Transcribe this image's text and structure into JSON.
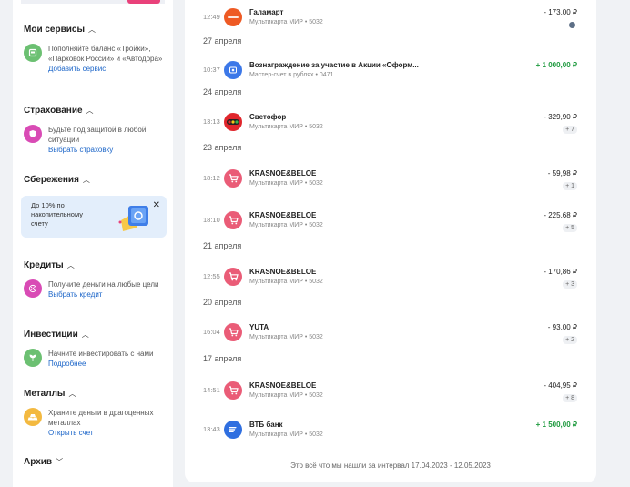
{
  "sidebar": {
    "services": {
      "title": "Мои сервисы",
      "text": "Пополняйте баланс «Тройки», «Парковок России» и «Автодора»",
      "link": "Добавить сервис",
      "icon": "parking-icon",
      "color": "#6cc072"
    },
    "insurance": {
      "title": "Страхование",
      "text": "Будьте под защитой в любой ситуации",
      "link": "Выбрать страховку",
      "icon": "shield-icon",
      "color": "#d94bb5"
    },
    "savings": {
      "title": "Сбережения",
      "promo_text": "До 10% по накопительному счету",
      "promo_close": "✕"
    },
    "credits": {
      "title": "Кредиты",
      "text": "Получите деньги на любые цели",
      "link": "Выбрать кредит",
      "icon": "percent-icon",
      "color": "#d94bb5"
    },
    "investments": {
      "title": "Инвестиции",
      "text": "Начните инвестировать с нами",
      "link": "Подробнее",
      "icon": "sprout-icon",
      "color": "#6cc072"
    },
    "metals": {
      "title": "Металлы",
      "text": "Храните деньги в драгоценных металлах",
      "link": "Открыть счет",
      "icon": "gold-bars-icon",
      "color": "#f3b940"
    },
    "archive": {
      "title": "Архив"
    }
  },
  "transactions": {
    "dates": [
      "27 апреля",
      "24 апреля",
      "23 апреля",
      "21 апреля",
      "20 апреля",
      "17 апреля"
    ],
    "items": [
      {
        "time": "12:49",
        "name": "Галамарт",
        "sub": "Мультикарта МИР • 5032",
        "amount": "- 173,00 ₽",
        "badge": "",
        "icon": "galamart-logo-icon",
        "color": "#ee5a24"
      },
      {
        "time": "10:37",
        "name": "Вознаграждение за участие в Акции «Оформ...",
        "sub": "Мастер-счет в рублях • 0471",
        "amount": "+ 1 000,00 ₽",
        "badge": "",
        "icon": "gift-icon",
        "color": "#3c78e8"
      },
      {
        "time": "13:13",
        "name": "Светофор",
        "sub": "Мультикарта МИР • 5032",
        "amount": "- 329,90 ₽",
        "badge": "+ 7",
        "icon": "traffic-light-icon",
        "color": "#e0262c"
      },
      {
        "time": "18:12",
        "name": "KRASNOE&BELOE",
        "sub": "Мультикарта МИР • 5032",
        "amount": "- 59,98 ₽",
        "badge": "+ 1",
        "icon": "cart-icon",
        "color": "#ea5c77"
      },
      {
        "time": "18:10",
        "name": "KRASNOE&BELOE",
        "sub": "Мультикарта МИР • 5032",
        "amount": "- 225,68 ₽",
        "badge": "+ 5",
        "icon": "cart-icon",
        "color": "#ea5c77"
      },
      {
        "time": "12:55",
        "name": "KRASNOE&BELOE",
        "sub": "Мультикарта МИР • 5032",
        "amount": "- 170,86 ₽",
        "badge": "+ 3",
        "icon": "cart-icon",
        "color": "#ea5c77"
      },
      {
        "time": "16:04",
        "name": "YUTA",
        "sub": "Мультикарта МИР • 5032",
        "amount": "- 93,00 ₽",
        "badge": "+ 2",
        "icon": "cart-icon",
        "color": "#ea5c77"
      },
      {
        "time": "14:51",
        "name": "KRASNOE&BELOE",
        "sub": "Мультикарта МИР • 5032",
        "amount": "- 404,95 ₽",
        "badge": "+ 8",
        "icon": "cart-icon",
        "color": "#ea5c77"
      },
      {
        "time": "13:43",
        "name": "ВТБ банк",
        "sub": "Мультикарта МИР • 5032",
        "amount": "+ 1 500,00 ₽",
        "badge": "",
        "icon": "vtb-logo-icon",
        "color": "#2f6fe0"
      }
    ],
    "footer": "Это всё что мы нашли за интервал 17.04.2023 - 12.05.2023"
  }
}
